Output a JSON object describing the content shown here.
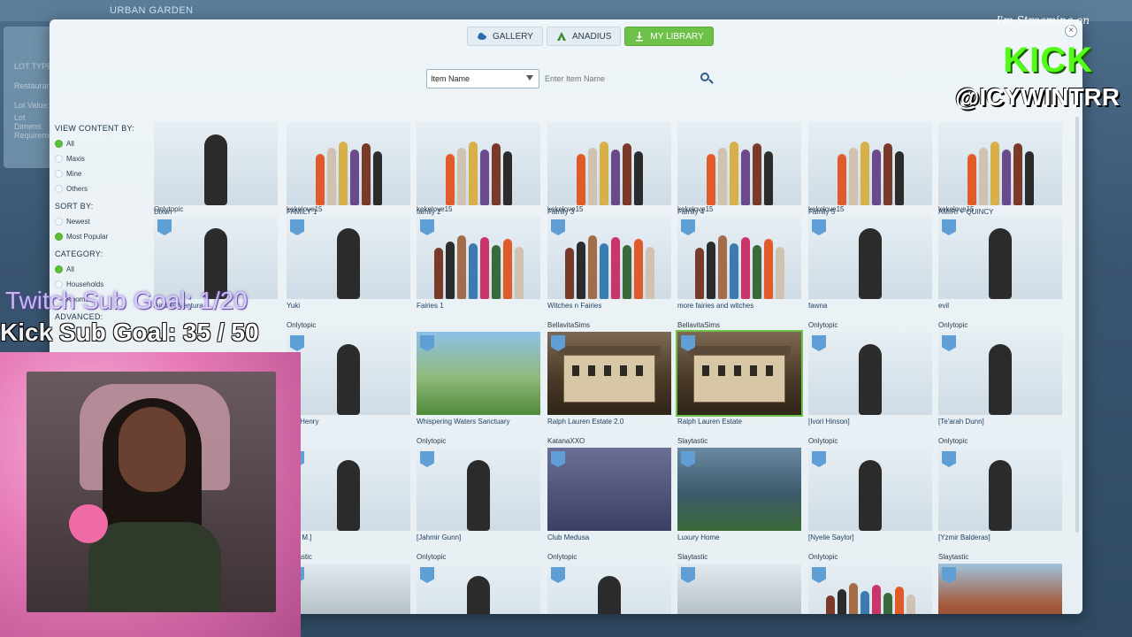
{
  "background": {
    "title": "URBAN GARDEN",
    "left_labels": [
      "LOT TYPE",
      "Restaurant",
      "Lot Value:",
      "Lot Dimens",
      "Requireme"
    ]
  },
  "tabs": [
    {
      "label": "GALLERY",
      "icon": "cloud-icon",
      "active": false
    },
    {
      "label": "ANADIUS",
      "icon": "a-logo-icon",
      "active": false
    },
    {
      "label": "MY LIBRARY",
      "icon": "download-icon",
      "active": true
    }
  ],
  "search": {
    "select_value": "Item Name",
    "placeholder": "Enter Item Name"
  },
  "sidebar": {
    "view_heading": "View Content By:",
    "view_options": [
      {
        "label": "All",
        "checked": true
      },
      {
        "label": "Maxis",
        "checked": false
      },
      {
        "label": "Mine",
        "checked": false
      },
      {
        "label": "Others",
        "checked": false
      }
    ],
    "sort_heading": "Sort By:",
    "sort_options": [
      {
        "label": "Newest",
        "checked": false
      },
      {
        "label": "Most Popular",
        "checked": true
      }
    ],
    "category_heading": "Category:",
    "category_options": [
      {
        "label": "All",
        "checked": true
      },
      {
        "label": "Households",
        "checked": false
      },
      {
        "label": "Rooms",
        "checked": false
      }
    ],
    "advanced_label": "ADVANCED:"
  },
  "grid": {
    "rows": [
      [
        {
          "creator": "",
          "name": "Dixon",
          "kind": "sim"
        },
        {
          "creator": "",
          "name": "FAMILY 1",
          "kind": "family"
        },
        {
          "creator": "",
          "name": "family 2",
          "kind": "family"
        },
        {
          "creator": "",
          "name": "Family 3",
          "kind": "family"
        },
        {
          "creator": "",
          "name": "Family 4",
          "kind": "family"
        },
        {
          "creator": "",
          "name": "Family 5",
          "kind": "family"
        },
        {
          "creator": "",
          "name": "AMIRI + QUINCY",
          "kind": "family"
        }
      ],
      [
        {
          "creator": "Onlytopic",
          "name": "Ainsley Ventura",
          "kind": "sim"
        },
        {
          "creator": "kekelove15",
          "name": "Yuki",
          "kind": "sim"
        },
        {
          "creator": "kekelove15",
          "name": "Fairies 1",
          "kind": "family"
        },
        {
          "creator": "kekelove15",
          "name": "Witches n Fairies",
          "kind": "family"
        },
        {
          "creator": "kekelove15",
          "name": "more fairies and witches",
          "kind": "family"
        },
        {
          "creator": "kekelove15",
          "name": "fawna",
          "kind": "sim"
        },
        {
          "creator": "kekelove15",
          "name": "evil",
          "kind": "sim"
        }
      ],
      [
        {
          "creator": "",
          "name": "",
          "kind": "hidden"
        },
        {
          "creator": "Onlytopic",
          "name": "van Henry",
          "kind": "sim"
        },
        {
          "creator": "",
          "name": "Whispering Waters Sanctuary",
          "kind": "lot"
        },
        {
          "creator": "BellavitaSims",
          "name": "Ralph Lauren Estate 2.0",
          "kind": "house"
        },
        {
          "creator": "BellavitaSims",
          "name": "Ralph Lauren Estate",
          "kind": "house",
          "selected": true
        },
        {
          "creator": "Onlytopic",
          "name": "[Ivori Hinson]",
          "kind": "sim"
        },
        {
          "creator": "Onlytopic",
          "name": "[Te'arah Dunn]",
          "kind": "sim"
        }
      ],
      [
        {
          "creator": "",
          "name": "",
          "kind": "hidden"
        },
        {
          "creator": "",
          "name": "quel M.]",
          "kind": "sim"
        },
        {
          "creator": "Onlytopic",
          "name": "[Jahmir Gunn]",
          "kind": "sim"
        },
        {
          "creator": "KatanaXXO",
          "name": "Club Medusa",
          "kind": "club"
        },
        {
          "creator": "Slaytastic",
          "name": "Luxury Home",
          "kind": "lux"
        },
        {
          "creator": "Onlytopic",
          "name": "[Nyelie Saylor]",
          "kind": "sim"
        },
        {
          "creator": "Onlytopic",
          "name": "[Yzmir Balderas]",
          "kind": "sim"
        }
      ],
      [
        {
          "creator": "",
          "name": "",
          "kind": "hidden"
        },
        {
          "creator": "laytastic",
          "name": "",
          "kind": "build"
        },
        {
          "creator": "Onlytopic",
          "name": "",
          "kind": "sim"
        },
        {
          "creator": "Onlytopic",
          "name": "",
          "kind": "sim"
        },
        {
          "creator": "Slaytastic",
          "name": "",
          "kind": "build"
        },
        {
          "creator": "Onlytopic",
          "name": "",
          "kind": "family"
        },
        {
          "creator": "Slaytastic",
          "name": "",
          "kind": "brick"
        }
      ]
    ]
  },
  "overlay": {
    "twitch_goal": "Twitch Sub Goal: 1/20",
    "kick_goal": "Kick Sub Goal: 35 / 50",
    "kick_live": "I'm Streaming on",
    "kick_logo": "KICK",
    "kick_handle": "@ICYWINTRR"
  },
  "colors": {
    "accent": "#6dc048",
    "kick_green": "#53fc18",
    "badge_blue": "#5f9fd6"
  }
}
